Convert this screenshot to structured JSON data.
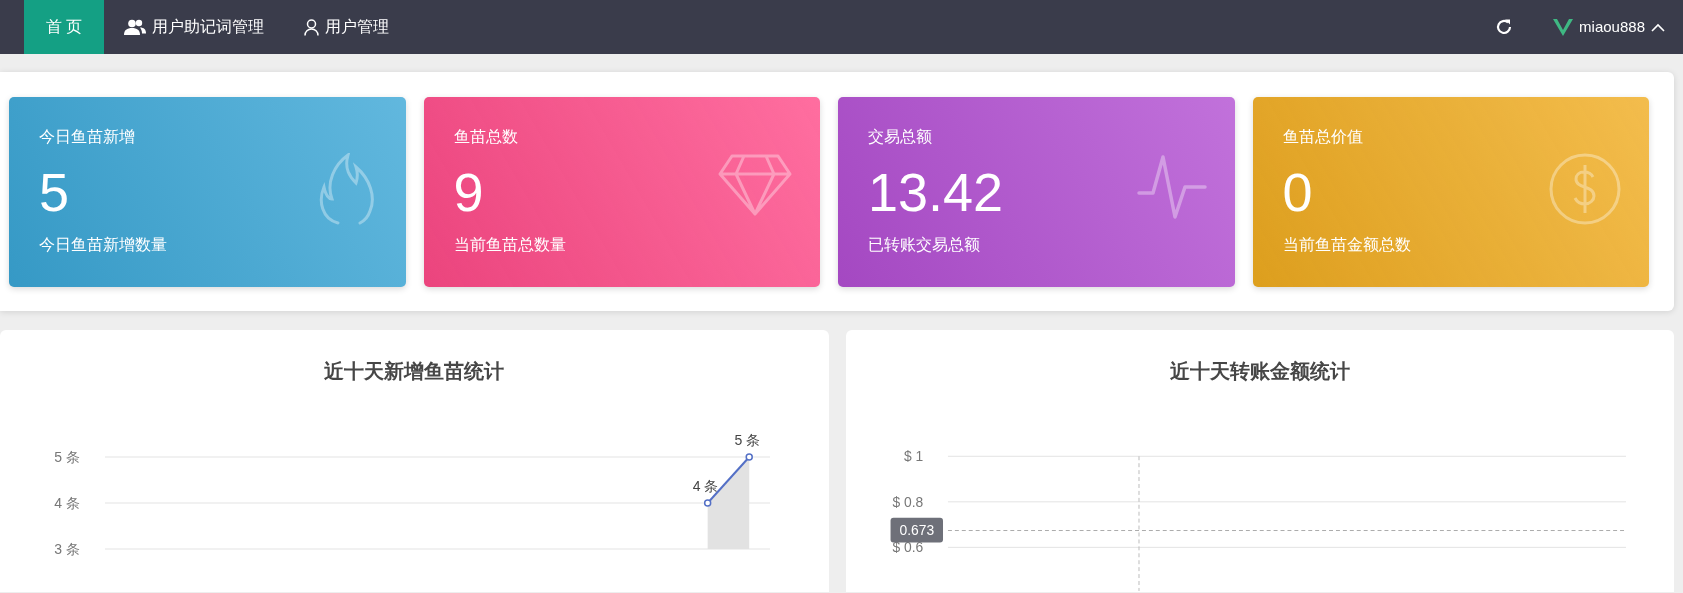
{
  "navbar": {
    "tabs": [
      {
        "label": "首页",
        "selected": true
      },
      {
        "label": "用户助记词管理",
        "selected": false
      },
      {
        "label": "用户管理",
        "selected": false
      }
    ],
    "username": "miaou888"
  },
  "stat_cards": [
    {
      "title": "今日鱼苗新增",
      "value": "5",
      "subtitle": "今日鱼苗新增数量",
      "color": "#3aa6d6"
    },
    {
      "title": "鱼苗总数",
      "value": "9",
      "subtitle": "当前鱼苗总数量",
      "color": "#ff4a88"
    },
    {
      "title": "交易总额",
      "value": "13.42",
      "subtitle": "已转账交易总额",
      "color": "#b24ed2"
    },
    {
      "title": "鱼苗总价值",
      "value": "0",
      "subtitle": "当前鱼苗金额总数",
      "color": "#f0ac20"
    }
  ],
  "charts": [
    {
      "title": "近十天新增鱼苗统计",
      "chart_data": {
        "type": "line",
        "ylim": [
          3,
          5
        ],
        "yticks": [
          {
            "value": 5,
            "label": "5 条"
          },
          {
            "value": 4,
            "label": "4 条"
          },
          {
            "value": 3,
            "label": "3 条"
          }
        ],
        "categories": [
          null,
          null,
          null,
          null,
          null,
          null,
          null,
          null,
          null,
          null,
          null,
          null,
          null,
          null,
          null,
          null
        ],
        "series": [
          {
            "color": "#5470c6",
            "marker": "circle",
            "values": [
              null,
              null,
              null,
              null,
              null,
              null,
              null,
              null,
              null,
              null,
              null,
              null,
              null,
              null,
              4,
              5
            ]
          }
        ],
        "value_labels": [
          null,
          null,
          null,
          null,
          null,
          null,
          null,
          null,
          null,
          null,
          null,
          null,
          null,
          null,
          "4 条",
          "5 条"
        ]
      }
    },
    {
      "title": "近十天转账金额统计",
      "axis_labels": [
        "$ 1",
        "$ 0.8",
        "$ 0.6"
      ],
      "pointer_label": "0.673"
    }
  ]
}
